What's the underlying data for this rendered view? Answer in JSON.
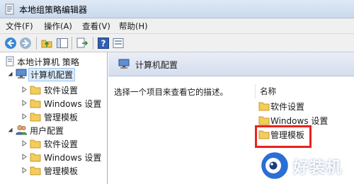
{
  "window": {
    "title": "本地组策略编辑器"
  },
  "menu": [
    {
      "label": "文件(F)"
    },
    {
      "label": "操作(A)"
    },
    {
      "label": "查看(V)"
    },
    {
      "label": "帮助(H)"
    }
  ],
  "tree": {
    "root": "本地计算机 策略",
    "computer_config": "计算机配置",
    "computer_children": [
      "软件设置",
      "Windows 设置",
      "管理模板"
    ],
    "user_config": "用户配置",
    "user_children": [
      "软件设置",
      "Windows 设置",
      "管理模板"
    ]
  },
  "detail": {
    "header_title": "计算机配置",
    "description": "选择一个项目来查看它的描述。",
    "column_name": "名称",
    "items": [
      "软件设置",
      "Windows 设置",
      "管理模板"
    ]
  },
  "watermark": {
    "text": "好装机"
  },
  "colors": {
    "highlight": "#e8231f",
    "folder": "#f4cc5a",
    "selection": "#dcecfc"
  }
}
